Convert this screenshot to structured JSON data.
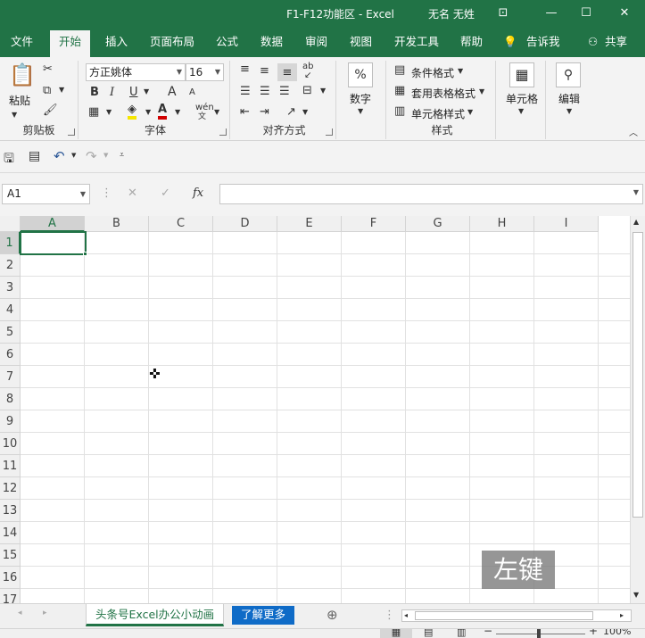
{
  "window": {
    "title": "F1-F12功能区  -  Excel",
    "user": "无名 无姓",
    "controls": [
      "⊡",
      "—",
      "☐",
      "✕"
    ]
  },
  "ribbon_tabs": [
    "文件",
    "开始",
    "插入",
    "页面布局",
    "公式",
    "数据",
    "审阅",
    "视图",
    "开发工具",
    "帮助"
  ],
  "active_tab": "开始",
  "tell_me": "告诉我",
  "share": "共享",
  "clipboard": {
    "paste": "粘贴",
    "label": "剪贴板"
  },
  "font": {
    "name": "方正姚体",
    "size": "16",
    "label": "字体",
    "bold": "B",
    "italic": "I",
    "underline": "U",
    "grow": "A",
    "shrink": "A",
    "color_letter": "A",
    "phonetic": "wén"
  },
  "alignment": {
    "label": "对齐方式"
  },
  "number": {
    "label": "数字",
    "symbol": "%"
  },
  "styles": {
    "conditional": "条件格式",
    "table": "套用表格格式",
    "cell": "单元格样式",
    "label": "样式"
  },
  "cells": {
    "label": "单元格"
  },
  "editing": {
    "label": "编辑"
  },
  "formula_bar": {
    "name_box": "A1",
    "cancel": "✕",
    "enter": "✓",
    "fx": "fx",
    "value": ""
  },
  "columns": [
    "A",
    "B",
    "C",
    "D",
    "E",
    "F",
    "G",
    "H",
    "I"
  ],
  "rows": [
    "1",
    "2",
    "3",
    "4",
    "5",
    "6",
    "7",
    "8",
    "9",
    "10",
    "11",
    "12",
    "13",
    "14",
    "15",
    "16",
    "17"
  ],
  "sheets": [
    "头条号Excel办公小动画",
    "了解更多"
  ],
  "zoom": "100%",
  "watermark": "左键",
  "colors": {
    "excel_green": "#217346",
    "link_blue": "#0f6bc7"
  }
}
